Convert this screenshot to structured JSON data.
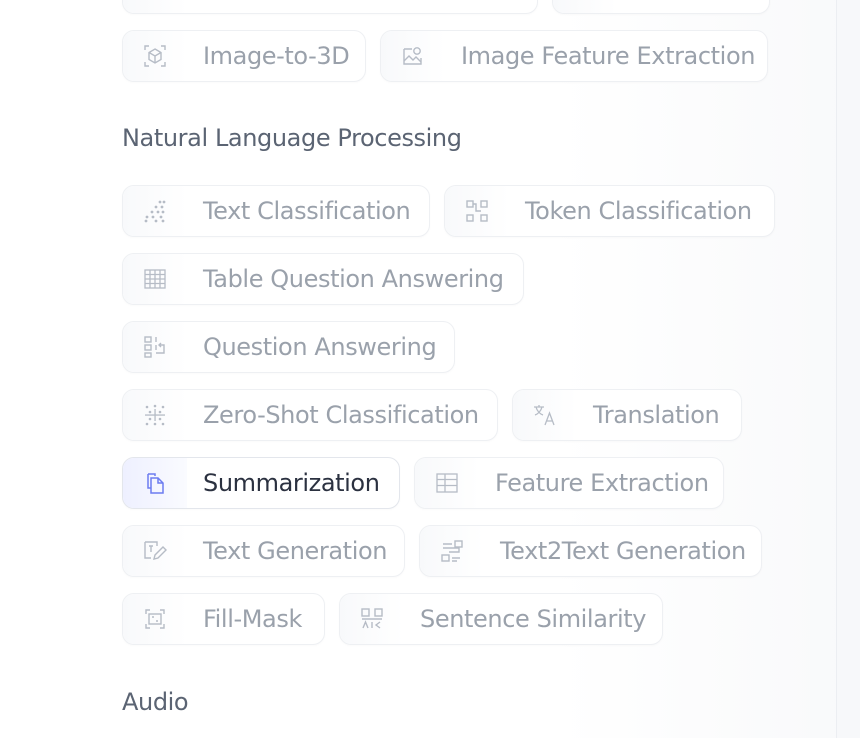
{
  "top_row": {
    "image_to_3d": "Image-to-3D",
    "image_feature_extraction": "Image Feature Extraction"
  },
  "nlp": {
    "title": "Natural Language Processing",
    "text_classification": "Text Classification",
    "token_classification": "Token Classification",
    "table_qa": "Table Question Answering",
    "question_answering": "Question Answering",
    "zero_shot": "Zero-Shot Classification",
    "translation": "Translation",
    "summarization": "Summarization",
    "feature_extraction": "Feature Extraction",
    "text_generation": "Text Generation",
    "text2text": "Text2Text Generation",
    "fill_mask": "Fill-Mask",
    "sentence_similarity": "Sentence Similarity"
  },
  "audio": {
    "title": "Audio"
  },
  "colors": {
    "active_icon": "#6c7cf0",
    "label": "#9aa1ab",
    "active_label": "#2b3140",
    "section_title": "#5b6473"
  }
}
